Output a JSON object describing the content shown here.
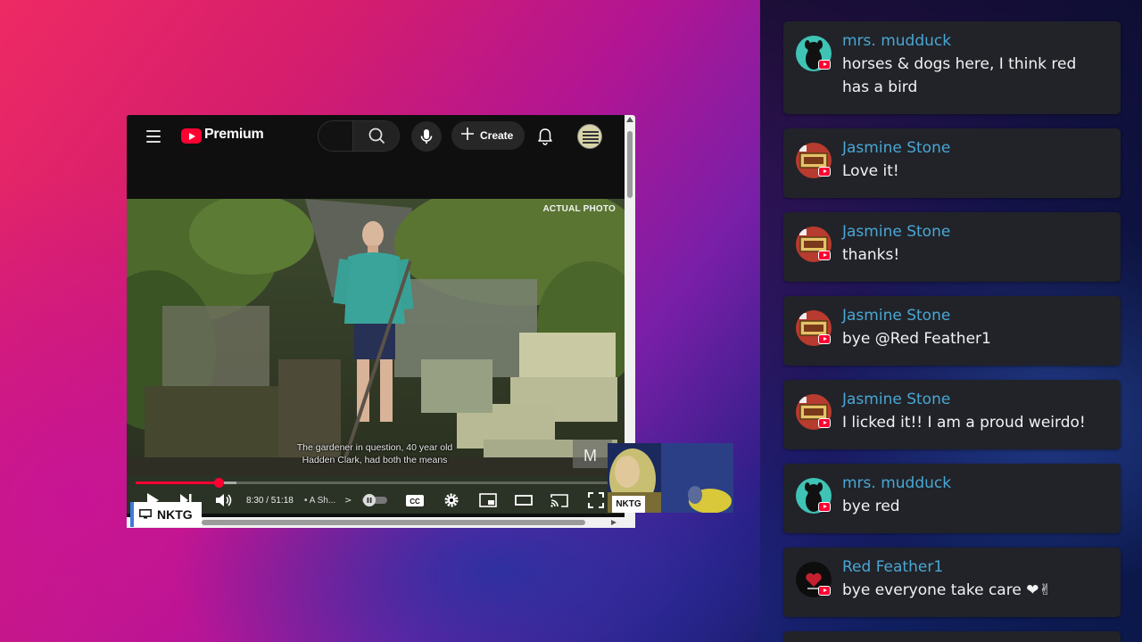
{
  "youtube": {
    "logo_text": "Premium",
    "search_placeholder": "",
    "create_label": "Create",
    "video": {
      "overlay_label": "ACTUAL PHOTO",
      "caption_line1": "The gardener in question, 40 year old",
      "caption_line2": "Hadden Clark, had both the means",
      "watermark": "M",
      "time": "8:30 / 51:18",
      "chapter": "• A Sh...",
      "chapter_chevron": ">",
      "progress": {
        "played_fraction": 0.173,
        "buffered_fraction": 0.21
      }
    }
  },
  "overlay_labels": {
    "nktg_main": "NKTG",
    "nktg_cam": "NKTG"
  },
  "chat": {
    "messages": [
      {
        "author": "mrs. mudduck",
        "text": "horses & dogs here, I think red has a bird",
        "avatar": "dog-avatar"
      },
      {
        "author": "Jasmine Stone",
        "text": "Love it!",
        "avatar": "plate-avatar"
      },
      {
        "author": "Jasmine Stone",
        "text": "thanks!",
        "avatar": "plate-avatar"
      },
      {
        "author": "Jasmine Stone",
        "text": "bye @Red Feather1",
        "avatar": "plate-avatar"
      },
      {
        "author": "Jasmine Stone",
        "text": "I licked it!! I am a proud weirdo!",
        "avatar": "plate-avatar"
      },
      {
        "author": "mrs. mudduck",
        "text": "bye red",
        "avatar": "dog-avatar"
      },
      {
        "author": "Red Feather1",
        "text": "bye everyone   take care ❤✌",
        "avatar": "heart-avatar"
      }
    ]
  },
  "colors": {
    "youtube_red": "#ff0033",
    "chat_name": "#49a7d3",
    "chat_bg": "#212329"
  }
}
